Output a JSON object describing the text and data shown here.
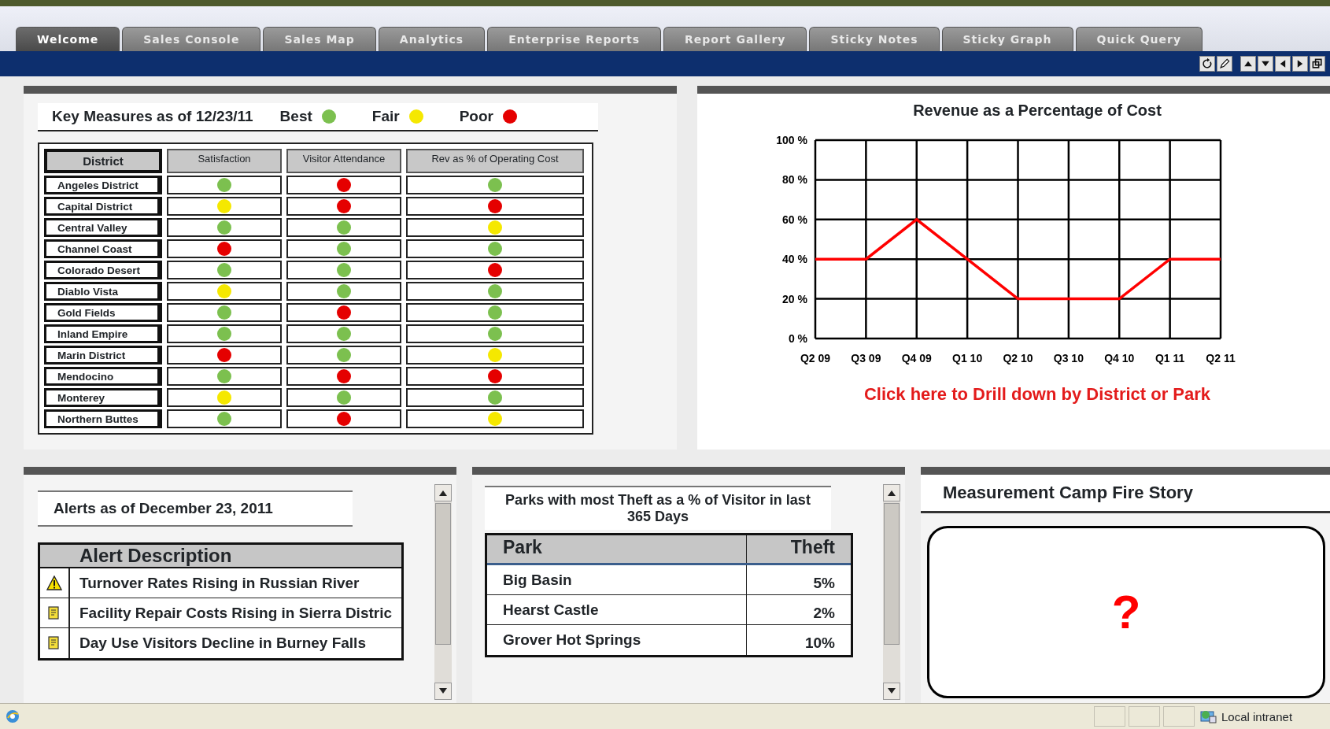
{
  "tabs": [
    {
      "label": "Welcome",
      "selected": true
    },
    {
      "label": "Sales Console",
      "selected": false
    },
    {
      "label": "Sales Map",
      "selected": false
    },
    {
      "label": "Analytics",
      "selected": false
    },
    {
      "label": "Enterprise Reports",
      "selected": false
    },
    {
      "label": "Report Gallery",
      "selected": false
    },
    {
      "label": "Sticky Notes",
      "selected": false
    },
    {
      "label": "Sticky Graph",
      "selected": false
    },
    {
      "label": "Quick Query",
      "selected": false
    }
  ],
  "key_measures": {
    "title": "Key Measures as of 12/23/11",
    "legend": [
      {
        "label": "Best",
        "color": "#7cc04f"
      },
      {
        "label": "Fair",
        "color": "#f5e800"
      },
      {
        "label": "Poor",
        "color": "#e50000"
      }
    ],
    "columns": [
      "District",
      "Satisfaction",
      "Visitor Attendance",
      "Rev as % of Operating Cost"
    ],
    "rows": [
      {
        "district": "Angeles District",
        "cells": [
          {
            "color": "#7cc04f"
          },
          {
            "color": "#e50000"
          },
          {
            "color": "#7cc04f"
          }
        ]
      },
      {
        "district": "Capital District",
        "cells": [
          {
            "color": "#f5e800"
          },
          {
            "color": "#e50000"
          },
          {
            "color": "#e50000"
          }
        ]
      },
      {
        "district": "Central Valley",
        "cells": [
          {
            "color": "#7cc04f"
          },
          {
            "color": "#7cc04f"
          },
          {
            "color": "#f5e800"
          }
        ]
      },
      {
        "district": "Channel Coast",
        "cells": [
          {
            "color": "#e50000"
          },
          {
            "color": "#7cc04f"
          },
          {
            "color": "#7cc04f"
          }
        ]
      },
      {
        "district": "Colorado Desert",
        "cells": [
          {
            "color": "#7cc04f"
          },
          {
            "color": "#7cc04f"
          },
          {
            "color": "#e50000"
          }
        ]
      },
      {
        "district": "Diablo Vista",
        "cells": [
          {
            "color": "#f5e800"
          },
          {
            "color": "#7cc04f"
          },
          {
            "color": "#7cc04f"
          }
        ]
      },
      {
        "district": "Gold Fields",
        "cells": [
          {
            "color": "#7cc04f"
          },
          {
            "color": "#e50000"
          },
          {
            "color": "#7cc04f"
          }
        ]
      },
      {
        "district": "Inland Empire",
        "cells": [
          {
            "color": "#7cc04f"
          },
          {
            "color": "#7cc04f"
          },
          {
            "color": "#7cc04f"
          }
        ]
      },
      {
        "district": "Marin District",
        "cells": [
          {
            "color": "#e50000"
          },
          {
            "color": "#7cc04f"
          },
          {
            "color": "#f5e800"
          }
        ]
      },
      {
        "district": "Mendocino",
        "cells": [
          {
            "color": "#7cc04f"
          },
          {
            "color": "#e50000"
          },
          {
            "color": "#e50000"
          }
        ]
      },
      {
        "district": "Monterey",
        "cells": [
          {
            "color": "#f5e800"
          },
          {
            "color": "#7cc04f"
          },
          {
            "color": "#7cc04f"
          }
        ]
      },
      {
        "district": "Northern Buttes",
        "cells": [
          {
            "color": "#7cc04f"
          },
          {
            "color": "#e50000"
          },
          {
            "color": "#f5e800"
          }
        ]
      }
    ]
  },
  "revenue": {
    "chart_data": {
      "type": "line",
      "title": "Revenue as a Percentage of Cost",
      "grid": true,
      "categories": [
        "Q2 09",
        "Q3 09",
        "Q4 09",
        "Q1 10",
        "Q2 10",
        "Q3 10",
        "Q4 10",
        "Q1 11",
        "Q2 11"
      ],
      "series": [
        {
          "color": "#ff0000",
          "values": [
            40,
            40,
            60,
            40,
            20,
            20,
            20,
            40,
            40
          ]
        }
      ],
      "ylim": [
        0,
        100
      ],
      "yticks": [
        {
          "value": 0,
          "label": "0 %"
        },
        {
          "value": 20,
          "label": "20 %"
        },
        {
          "value": 40,
          "label": "40 %"
        },
        {
          "value": 60,
          "label": "60 %"
        },
        {
          "value": 80,
          "label": "80 %"
        },
        {
          "value": 100,
          "label": "100 %"
        }
      ]
    },
    "link": "Click here to Drill down by District or Park"
  },
  "alerts": {
    "title": "Alerts as of December 23, 2011",
    "column": "Alert Description",
    "rows": [
      {
        "kind": "warning",
        "text": "Turnover Rates Rising in Russian River"
      },
      {
        "kind": "note",
        "text": "Facility Repair Costs Rising in Sierra Distric"
      },
      {
        "kind": "note",
        "text": "Day Use Visitors Decline in Burney Falls"
      }
    ]
  },
  "theft": {
    "title": "Parks with most Theft as a % of Visitor in last 365 Days",
    "columns": [
      "Park",
      "Theft"
    ],
    "rows": [
      {
        "park": "Big Basin",
        "theft": "5%"
      },
      {
        "park": "Hearst Castle",
        "theft": "2%"
      },
      {
        "park": "Grover Hot Springs",
        "theft": "10%"
      }
    ]
  },
  "story": {
    "title": "Measurement Camp Fire Story",
    "symbol": "?"
  },
  "status_bar": {
    "zone": "Local intranet"
  }
}
